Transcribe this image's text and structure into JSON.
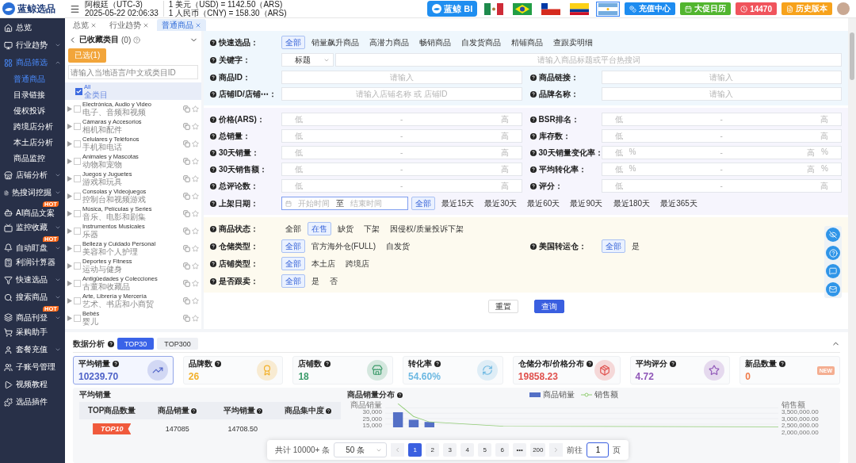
{
  "header": {
    "logo": "蓝鲸选品",
    "region": "阿根廷（UTC-3)",
    "time": "2025-05-22 02:06:33",
    "rates": [
      "1 美元（USD) = 1142.50（ARS)",
      "1 人民币（CNY) = 158.30（ARS)"
    ],
    "bi_badge": "蓝鲸 BI",
    "flags": [
      {
        "kind": "mexico",
        "selected": false
      },
      {
        "kind": "brazil",
        "selected": false
      },
      {
        "kind": "chile",
        "selected": false
      },
      {
        "kind": "colombia",
        "selected": false
      },
      {
        "kind": "argentina",
        "selected": true
      }
    ],
    "buttons": [
      {
        "label": "充值中心",
        "kind": "coins",
        "color": "#1d8cf0"
      },
      {
        "label": "大促日历",
        "kind": "calendar",
        "color": "#52b52f"
      },
      {
        "label": "14470",
        "kind": "clock",
        "color": "#f0545c"
      },
      {
        "label": "历史版本",
        "kind": "document",
        "color": "#f7a21b"
      }
    ]
  },
  "sidebar": {
    "items": [
      {
        "label": "总览",
        "kind": "home",
        "selected": false
      },
      {
        "label": "行业趋势",
        "kind": "monitor",
        "selected": false,
        "expanded": false
      },
      {
        "label": "商品筛选",
        "kind": "grid",
        "selected": true,
        "expanded": true,
        "children": [
          {
            "label": "普通商品",
            "selected": true
          },
          {
            "label": "目录链接",
            "selected": false
          },
          {
            "label": "侵权投诉",
            "selected": false
          },
          {
            "label": "跨境店分析",
            "selected": false
          },
          {
            "label": "本土店分析",
            "selected": false
          },
          {
            "label": "商品监控",
            "selected": false
          }
        ]
      },
      {
        "label": "店铺分析",
        "kind": "store",
        "selected": false,
        "expanded": false
      },
      {
        "label": "热搜词挖掘",
        "kind": "file",
        "selected": false,
        "expanded": false
      },
      {
        "label": "AI商品文案",
        "kind": "bot",
        "selected": false,
        "badge": "HOT"
      },
      {
        "label": "监控收藏",
        "kind": "tv",
        "selected": false,
        "expanded": false
      },
      {
        "label": "自动盯盘",
        "kind": "bell",
        "selected": false,
        "badge": "HOT",
        "expanded": false
      },
      {
        "label": "利润计算器",
        "kind": "calculator",
        "selected": false
      },
      {
        "label": "快速选品",
        "kind": "filter",
        "selected": false,
        "expanded": false
      },
      {
        "label": "搜索商品",
        "kind": "search",
        "selected": false,
        "expanded": false
      },
      {
        "label": "商品刊登",
        "kind": "layers",
        "selected": false,
        "badge": "HOT",
        "expanded": false
      },
      {
        "label": "采购助手",
        "kind": "cart",
        "selected": false
      },
      {
        "label": "套餐充值",
        "kind": "user",
        "selected": false,
        "expanded": false
      },
      {
        "label": "子账号管理",
        "kind": "users",
        "selected": false
      },
      {
        "label": "视频教程",
        "kind": "play",
        "selected": false
      },
      {
        "label": "选品插件",
        "kind": "puzzle",
        "selected": false
      }
    ]
  },
  "tabs": [
    {
      "label": "总览",
      "selected": false
    },
    {
      "label": "行业趋势",
      "selected": false
    },
    {
      "label": "普通商品",
      "selected": true
    }
  ],
  "categories": {
    "title": "已收藏类目",
    "count": "(0)",
    "picked_button": "已选(1)",
    "placeholder": "请输入当地语言/中文或类目ID",
    "items": [
      {
        "kind": "all",
        "label": "All",
        "sublabel": "全类目",
        "checked": true,
        "selected": true
      },
      {
        "kind": "category",
        "label": "Electrónica, Audio y Video",
        "sublabel": "电子、音频和视频",
        "checked": false,
        "selected": false
      },
      {
        "kind": "category",
        "label": "Cámaras y Accesorios",
        "sublabel": "相机和配件",
        "checked": false,
        "selected": false
      },
      {
        "kind": "category",
        "label": "Celulares y Teléfonos",
        "sublabel": "手机和电话",
        "checked": false,
        "selected": false
      },
      {
        "kind": "category",
        "label": "Animales y Mascotas",
        "sublabel": "动物和宠物",
        "checked": false,
        "selected": false
      },
      {
        "kind": "category",
        "label": "Juegos y Juguetes",
        "sublabel": "游戏和玩具",
        "checked": false,
        "selected": false
      },
      {
        "kind": "category",
        "label": "Consolas y Videojuegos",
        "sublabel": "控制台和视频游戏",
        "checked": false,
        "selected": false
      },
      {
        "kind": "category",
        "label": "Música, Películas y Series",
        "sublabel": "音乐、电影和剧集",
        "checked": false,
        "selected": false
      },
      {
        "kind": "category",
        "label": "Instrumentos Musicales",
        "sublabel": "乐器",
        "checked": false,
        "selected": false
      },
      {
        "kind": "category",
        "label": "Belleza y Cuidado Personal",
        "sublabel": "美容和个人护理",
        "checked": false,
        "selected": false
      },
      {
        "kind": "category",
        "label": "Deportes y Fitness",
        "sublabel": "运动与健身",
        "checked": false,
        "selected": false
      },
      {
        "kind": "category",
        "label": "Antigüedades y Colecciones",
        "sublabel": "古董和收藏品",
        "checked": false,
        "selected": false
      },
      {
        "kind": "category",
        "label": "Arte, Librería y Mercería",
        "sublabel": "艺术、书店和小商贸",
        "checked": false,
        "selected": false
      },
      {
        "kind": "category",
        "label": "Bebés",
        "sublabel": "婴儿",
        "checked": false,
        "selected": false
      }
    ]
  },
  "filters": {
    "quick_pick": {
      "label": "快速选品：",
      "options": [
        {
          "label": "全部",
          "selected": true
        },
        {
          "label": "销量飙升商品",
          "selected": false
        },
        {
          "label": "高潜力商品",
          "selected": false
        },
        {
          "label": "畅销商品",
          "selected": false
        },
        {
          "label": "自发货商品",
          "selected": false
        },
        {
          "label": "精铺商品",
          "selected": false
        },
        {
          "label": "查跟卖明细",
          "selected": false
        }
      ]
    },
    "keyword": {
      "label": "关键字：",
      "select": "标题",
      "placeholder": "请输入商品标题或平台热搜词"
    },
    "text_fields": [
      {
        "label": "商品ID：",
        "placeholder": "请输入"
      },
      {
        "label": "商品链接：",
        "placeholder": "请输入"
      },
      {
        "label": "店铺ID/店铺⋯：",
        "placeholder": "请输入店铺名称 或 店铺ID"
      },
      {
        "label": "品牌名称：",
        "placeholder": "请输入"
      }
    ],
    "ranges": [
      {
        "label": "价格(ARS)：",
        "low": "低",
        "separator": "-",
        "high": "高"
      },
      {
        "label": "BSR排名：",
        "low": "低",
        "separator": "-",
        "high": "高"
      },
      {
        "label": "总销量：",
        "low": "低",
        "separator": "-",
        "high": "高"
      },
      {
        "label": "库存数：",
        "low": "低",
        "separator": "-",
        "high": "高"
      },
      {
        "label": "30天销量：",
        "low": "低",
        "separator": "-",
        "high": "高"
      },
      {
        "label": "30天销量变化率：",
        "low": "低",
        "separator": "-",
        "high": "高",
        "unit": "%"
      },
      {
        "label": "30天销售额：",
        "low": "低",
        "separator": "-",
        "high": "高"
      },
      {
        "label": "平均转化率：",
        "low": "低",
        "separator": "-",
        "high": "高",
        "unit": "%"
      },
      {
        "label": "总评论数：",
        "low": "低",
        "separator": "-",
        "high": "高"
      },
      {
        "label": "评分：",
        "low": "低",
        "separator": "-",
        "high": "高"
      }
    ],
    "listing_date": {
      "label": "上架日期：",
      "start": "开始时间",
      "to": "至",
      "end": "结束时间",
      "options": [
        {
          "label": "全部",
          "selected": true
        },
        {
          "label": "最近15天",
          "selected": false
        },
        {
          "label": "最近30天",
          "selected": false
        },
        {
          "label": "最近60天",
          "selected": false
        },
        {
          "label": "最近90天",
          "selected": false
        },
        {
          "label": "最近180天",
          "selected": false
        },
        {
          "label": "最近365天",
          "selected": false
        }
      ]
    },
    "status_rows": [
      [
        {
          "label": "商品状态：",
          "options": [
            {
              "label": "全部",
              "selected": false
            },
            {
              "label": "在售",
              "selected": true
            },
            {
              "label": "缺货",
              "selected": false
            },
            {
              "label": "下架",
              "selected": false
            },
            {
              "label": "因侵权/质量投诉下架",
              "selected": false
            }
          ]
        }
      ],
      [
        {
          "label": "仓储类型：",
          "options": [
            {
              "label": "全部",
              "selected": true
            },
            {
              "label": "官方海外仓(FULL)",
              "selected": false
            },
            {
              "label": "自发货",
              "selected": false
            }
          ]
        },
        {
          "label": "美国转运仓：",
          "options": [
            {
              "label": "全部",
              "selected": true
            },
            {
              "label": "是",
              "selected": false
            }
          ]
        }
      ],
      [
        {
          "label": "店铺类型：",
          "options": [
            {
              "label": "全部",
              "selected": true
            },
            {
              "label": "本土店",
              "selected": false
            },
            {
              "label": "跨境店",
              "selected": false
            }
          ]
        }
      ],
      [
        {
          "label": "是否跟卖：",
          "options": [
            {
              "label": "全部",
              "selected": true
            },
            {
              "label": "是",
              "selected": false
            },
            {
              "label": "否",
              "selected": false
            }
          ]
        }
      ]
    ],
    "actions": [
      {
        "label": "重置",
        "kind": "secondary"
      },
      {
        "label": "查询",
        "kind": "primary"
      }
    ]
  },
  "analysis": {
    "title": "数据分析",
    "tabs": [
      {
        "label": "TOP30",
        "selected": true
      },
      {
        "label": "TOP300",
        "selected": false
      }
    ],
    "cards": [
      {
        "label": "平均销量",
        "value": "10239.70",
        "kind": "chart",
        "color": "#4f63c8",
        "selected": true
      },
      {
        "label": "品牌数",
        "value": "26",
        "kind": "medal",
        "color": "#f2b12c",
        "selected": false
      },
      {
        "label": "店铺数",
        "value": "18",
        "kind": "store",
        "color": "#3b9b6a",
        "selected": false
      },
      {
        "label": "转化率",
        "value": "54.60%",
        "kind": "cycle",
        "color": "#6cb8e2",
        "selected": false
      },
      {
        "label": "仓储分布/价格分布",
        "value": "19858.23",
        "kind": "box",
        "color": "#e0504c",
        "selected": false
      },
      {
        "label": "平均评分",
        "value": "4.72",
        "kind": "star",
        "color": "#9057b8",
        "selected": false
      },
      {
        "label": "新品数量",
        "value": "0",
        "kind": "new",
        "tag": "NEW",
        "color": "#f07c4a",
        "selected": false
      }
    ],
    "table": {
      "title": "平均销量",
      "columns": [
        {
          "label": "TOP商品数量",
          "help": false
        },
        {
          "label": "商品销量",
          "help": true
        },
        {
          "label": "平均销量",
          "help": true
        },
        {
          "label": "商品集中度",
          "help": true
        }
      ],
      "rows": [
        {
          "cells": [
            {
              "kind": "badge",
              "text": "TOP10"
            },
            {
              "kind": "text",
              "text": "147085"
            },
            {
              "kind": "text",
              "text": "14708.50"
            }
          ]
        }
      ]
    },
    "sales_chart": {
      "title": "商品销量分布",
      "legend": [
        {
          "label": "商品销量",
          "kind": "bar"
        },
        {
          "label": "销售额",
          "kind": "line"
        }
      ],
      "left_title": "商品销量",
      "left_ticks": [
        "30,000",
        "25,000",
        "15,000"
      ],
      "right_title": "销售额",
      "right_ticks": [
        "3,500,000.00",
        "3,000,000.00",
        "2,500,000.00",
        "2,000,000.00"
      ]
    },
    "pagination": {
      "total": "共计 10000+ 条",
      "page_size": "50 条",
      "pages": [
        {
          "label": "1",
          "selected": true
        },
        {
          "label": "2",
          "selected": false
        },
        {
          "label": "3",
          "selected": false
        },
        {
          "label": "4",
          "selected": false
        },
        {
          "label": "5",
          "selected": false
        },
        {
          "label": "6",
          "selected": false
        },
        {
          "label": "•••",
          "selected": false
        },
        {
          "label": "200",
          "selected": false
        }
      ],
      "goto_label": "前往",
      "goto_value": "1",
      "goto_suffix": "页"
    }
  }
}
